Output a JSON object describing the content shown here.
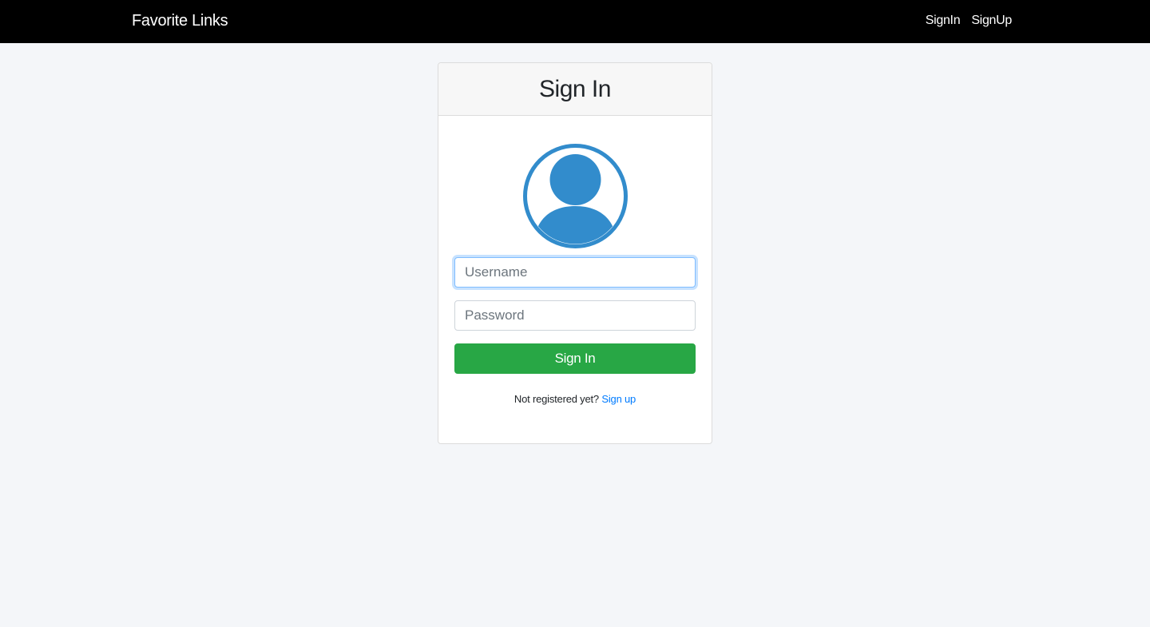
{
  "navbar": {
    "brand": "Favorite Links",
    "links": [
      {
        "label": "SignIn"
      },
      {
        "label": "SignUp"
      }
    ]
  },
  "card": {
    "title": "Sign In",
    "avatar_icon": "user-avatar-icon",
    "username": {
      "placeholder": "Username",
      "value": ""
    },
    "password": {
      "placeholder": "Password",
      "value": ""
    },
    "submit_label": "Sign In",
    "footer": {
      "prompt": "Not registered yet?",
      "link_label": "Sign up"
    }
  },
  "colors": {
    "navbar_bg": "#000000",
    "page_bg": "#f4f6f9",
    "avatar": "#328ccc",
    "submit_bg": "#28a745",
    "link": "#007bff"
  }
}
